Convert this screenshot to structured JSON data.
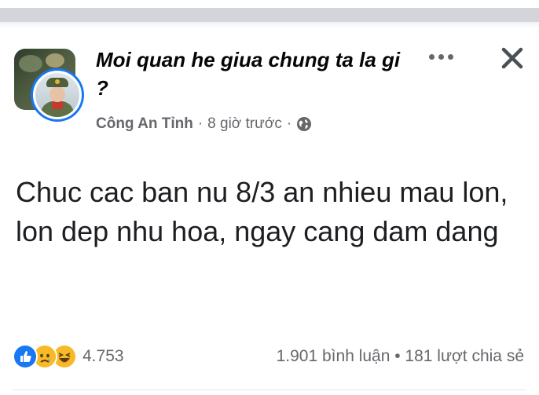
{
  "post": {
    "group_name": "Moi quan he giua chung ta la gi ?",
    "author": "Công An Tỉnh",
    "separator": "·",
    "time": "8 giờ trước",
    "body": "Chuc cac ban nu 8/3 an nhieu mau lon, lon dep nhu hoa, ngay cang dam dang",
    "privacy_icon": "globe-icon"
  },
  "actions": {
    "more_icon": "more-horizontal-icon",
    "close_icon": "close-icon"
  },
  "footer": {
    "reaction_icons": [
      "like-icon",
      "sad-icon",
      "haha-icon"
    ],
    "reaction_count": "4.753",
    "engagement": "1.901 bình luận • 181 lượt chia sẻ"
  },
  "colors": {
    "brand": "#1877f2",
    "secondary_text": "#65676b",
    "reaction_yellow": "#f7b928"
  }
}
